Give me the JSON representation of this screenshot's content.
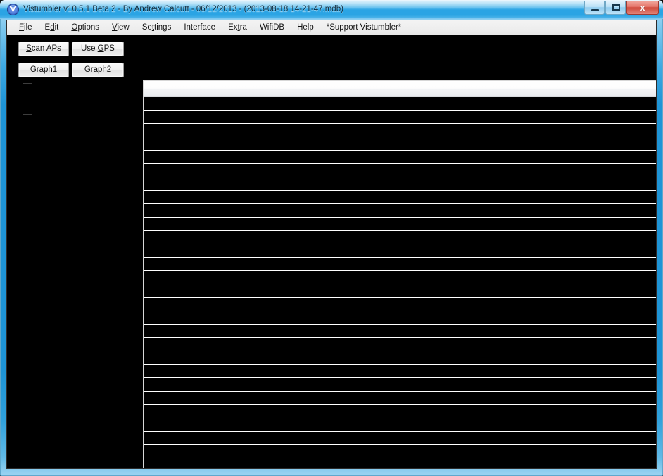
{
  "window": {
    "title": "Vistumbler v10.5.1 Beta 2 - By Andrew Calcutt - 06/12/2013 - (2013-08-18 14-21-47.mdb)",
    "app_icon": "vistumbler-shield-icon",
    "controls": {
      "minimize": "minimize-icon",
      "maximize": "maximize-icon",
      "close_label": "x"
    },
    "frame_color": "#1e94d6",
    "titlebar_text_color": "#0c2a3d"
  },
  "menubar": {
    "items": [
      {
        "label": "File",
        "accel_index": 0
      },
      {
        "label": "Edit",
        "accel_index": 1
      },
      {
        "label": "Options",
        "accel_index": 0
      },
      {
        "label": "View",
        "accel_index": 0
      },
      {
        "label": "Settings",
        "accel_index": 2
      },
      {
        "label": "Interface",
        "accel_index": -1
      },
      {
        "label": "Extra",
        "accel_index": 2
      },
      {
        "label": "WifiDB",
        "accel_index": -1
      },
      {
        "label": "Help",
        "accel_index": -1
      },
      {
        "label": "*Support Vistumbler*",
        "accel_index": -1
      }
    ]
  },
  "toolbar": {
    "scan_aps": {
      "label": "Scan APs",
      "accel_index": 0
    },
    "use_gps": {
      "label": "Use GPS",
      "accel_index": 4
    },
    "graph1": {
      "label": "Graph1",
      "accel_index": 5
    },
    "graph2": {
      "label": "Graph2",
      "accel_index": 5
    }
  },
  "tree_pane": {
    "background": "#000000",
    "nodes": [],
    "connector_style": "dotted",
    "connector_color": "#7a7a7a",
    "branch_count": 4
  },
  "list_pane": {
    "background": "#000000",
    "header_columns": [],
    "gridline_color": "#ffffff",
    "row_count": 28,
    "rows": []
  }
}
